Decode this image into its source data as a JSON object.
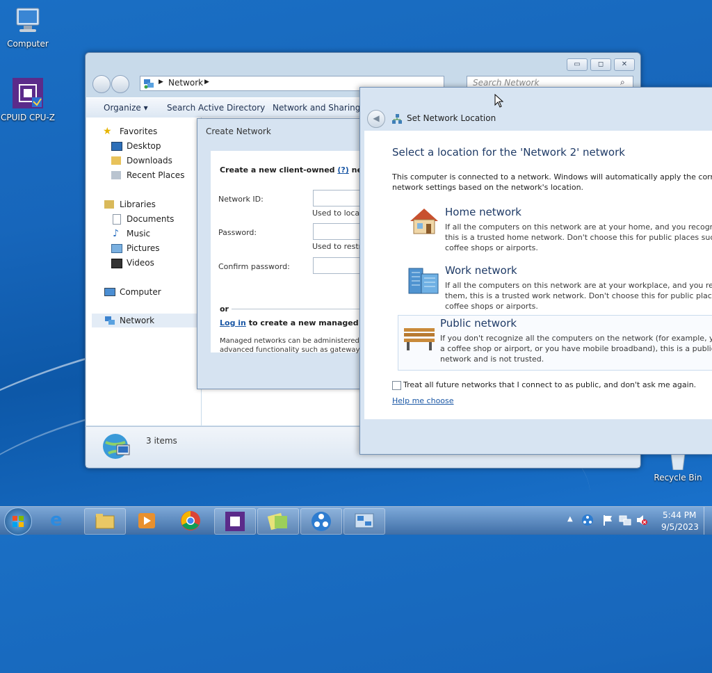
{
  "desktop": {
    "icons": [
      {
        "label": "Computer"
      },
      {
        "label": "CPUID CPU-Z"
      },
      {
        "label": "Recycle Bin"
      }
    ]
  },
  "explorer": {
    "breadcrumb": "Network",
    "search_placeholder": "Search Network",
    "toolbar": {
      "organize": "Organize ▾",
      "search_ad": "Search Active Directory",
      "network_sharing": "Network and Sharing C"
    },
    "nav": {
      "favorites": "Favorites",
      "desktop": "Desktop",
      "downloads": "Downloads",
      "recent_places": "Recent Places",
      "libraries": "Libraries",
      "documents": "Documents",
      "music": "Music",
      "pictures": "Pictures",
      "videos": "Videos",
      "computer": "Computer",
      "network": "Network"
    },
    "status": "3 items"
  },
  "create_network": {
    "title": "Create Network",
    "heading_pre": "Create a new client-owned",
    "heading_link": "(?)",
    "heading_post": "netw",
    "network_id_label": "Network ID:",
    "network_id_hint": "Used to locate",
    "password_label": "Password:",
    "password_hint": "Used to restric",
    "confirm_label": "Confirm password:",
    "or": "or",
    "login_link": "Log in",
    "login_text": "to create a new managed",
    "login_q": "(?)",
    "managed_line1": "Managed networks can be administered ce",
    "managed_line2": "advanced functionality such as gateway n"
  },
  "set_network_location": {
    "title": "Set Network Location",
    "heading": "Select a location for the 'Network  2' network",
    "intro_line1": "This computer is connected to a network. Windows will automatically apply the correct",
    "intro_line2": "network settings based on the network's location.",
    "options": [
      {
        "title": "Home network",
        "desc1": "If all the computers on this network are at your home, and you recognize th",
        "desc2": "this is a trusted home network.  Don't choose this for public places such as",
        "desc3": "coffee shops or airports."
      },
      {
        "title": "Work network",
        "desc1": "If all the computers on this network are at your workplace, and you recogn",
        "desc2": "them, this is a trusted work network.  Don't choose this for public places su",
        "desc3": "coffee shops or airports."
      },
      {
        "title": "Public network",
        "desc1": "If you don't recognize all the computers on the network (for example, you'r",
        "desc2": "a coffee shop or airport, or you have mobile broadband), this is a public",
        "desc3": "network and is not trusted."
      }
    ],
    "checkbox_label": "Treat all future networks that I connect to as public, and don't ask me again.",
    "help_link": "Help me choose"
  },
  "taskbar": {
    "time": "5:44 PM",
    "date": "9/5/2023"
  }
}
